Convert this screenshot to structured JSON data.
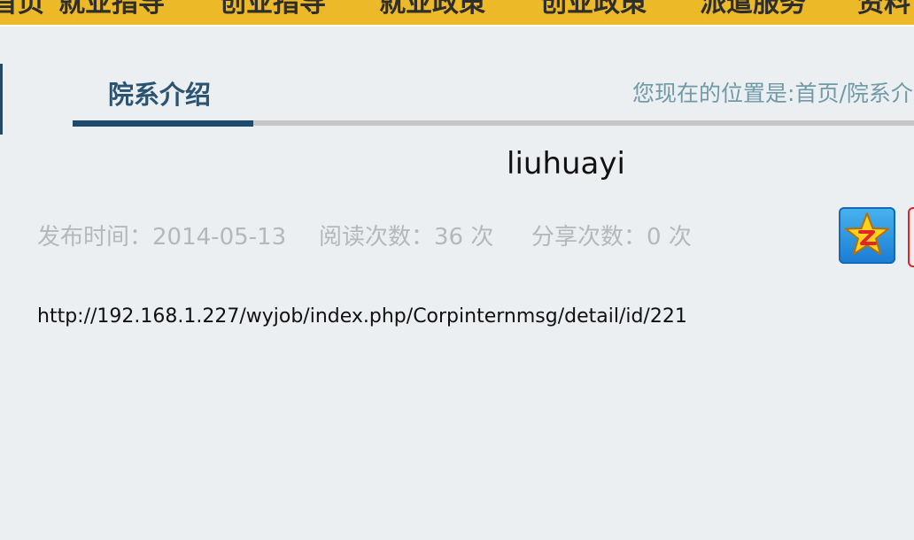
{
  "nav": {
    "items": [
      "导航首页",
      "就业指导",
      "创业指导",
      "就业政策",
      "创业政策",
      "派遣服务",
      "资料下载"
    ]
  },
  "section": {
    "title": "院系介绍",
    "breadcrumb_label": "您现在的位置是:",
    "breadcrumb_home": "首页",
    "breadcrumb_sep": "/",
    "breadcrumb_current": "院系介绍"
  },
  "article": {
    "title": "liuhuayi",
    "publish_label": "发布时间：",
    "publish_date": "2014-05-13",
    "reads_label": "阅读次数：",
    "reads_count": "36",
    "reads_unit": " 次",
    "shares_label": "分享次数：",
    "shares_count": "0",
    "shares_unit": " 次",
    "body_url": "http://192.168.1.227/wyjob/index.php/Corpinternmsg/detail/id/221"
  },
  "share": {
    "icons": [
      "qq-zone-share-icon",
      "weibo-share-icon"
    ]
  },
  "colors": {
    "nav_bg": "#ecb928",
    "page_bg": "#eceff1",
    "accent_blue": "#1d4a6d",
    "title_blue": "#2b5472",
    "breadcrumb": "#6f9aa6",
    "meta_gray": "#b5b7b9"
  }
}
